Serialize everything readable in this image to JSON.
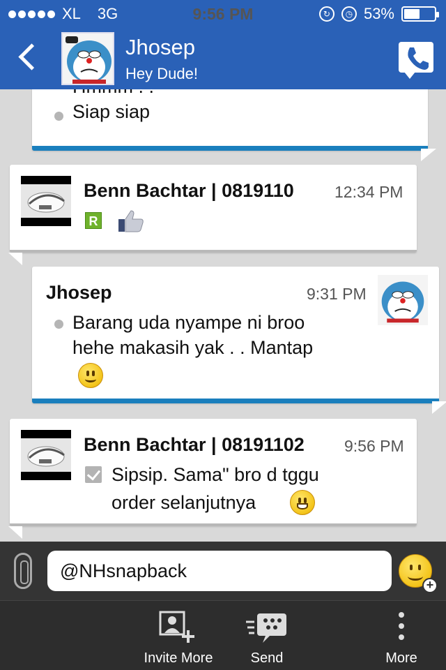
{
  "status_bar": {
    "carrier": "XL",
    "network": "3G",
    "time": "9:56 PM",
    "battery": "53%",
    "battery_level": 0.53
  },
  "header": {
    "contact_name": "Jhosep",
    "contact_status": "Hey Dude!",
    "back_icon": "chevron-left-icon",
    "call_icon": "phone-icon"
  },
  "messages": [
    {
      "sender": "",
      "time": "",
      "text": "Siap siap",
      "clipped_text": "Hmmm . .",
      "mine": true
    },
    {
      "sender": "Benn Bachtar | 0819110",
      "time": "12:34 PM",
      "text": "",
      "mine": false
    },
    {
      "sender": "Jhosep",
      "time": "9:31 PM",
      "text_line1": "Barang uda nyampe ni broo",
      "text_line2": "hehe makasih yak . . Mantap",
      "mine": true
    },
    {
      "sender": "Benn Bachtar | 08191102",
      "time": "9:56 PM",
      "text_line1": "Sipsip. Sama\" bro d tggu",
      "text_line2": "order selanjutnya",
      "mine": false
    }
  ],
  "input": {
    "value": "@NHsnapback"
  },
  "toolbar": {
    "invite_label": "Invite More",
    "send_label": "Send",
    "more_label": "More"
  },
  "colors": {
    "header_blue": "#2a61b7",
    "mine_accent": "#1a7fbd",
    "toolbar_bg": "#2d2d2d"
  }
}
